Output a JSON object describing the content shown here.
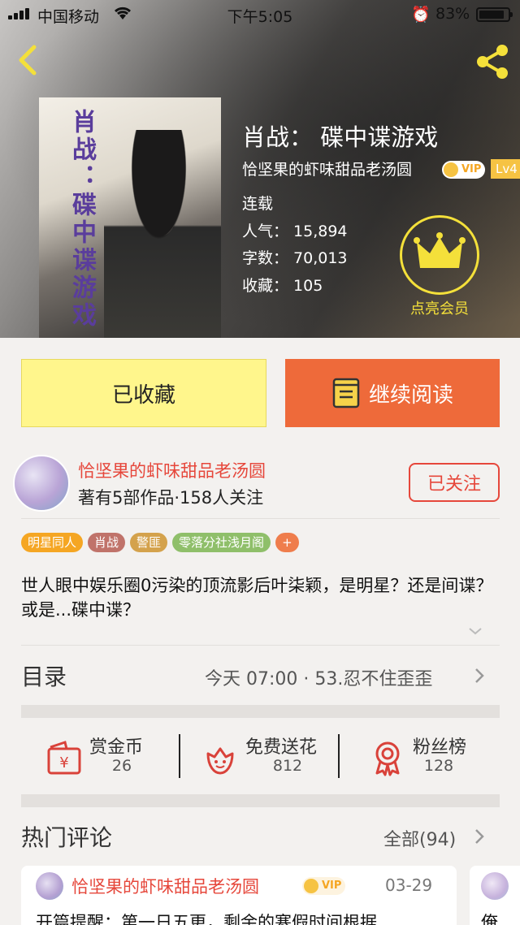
{
  "status": {
    "carrier": "中国移动",
    "time": "下午5:05",
    "battery": "83%"
  },
  "book": {
    "title": "肖战： 碟中谍游戏",
    "cover_text": "肖战：碟中谍游戏",
    "author": "恰坚果的虾味甜品老汤圆",
    "vip": "VIP",
    "level": "Lv4",
    "status": "连载",
    "popularity_label": "人气：",
    "popularity": "15,894",
    "words_label": "字数：",
    "words": "70,013",
    "favorites_label": "收藏：",
    "favorites": "105",
    "member_label": "点亮会员"
  },
  "actions": {
    "collected": "已收藏",
    "continue_read": "继续阅读"
  },
  "author_row": {
    "name": "恰坚果的虾味甜品老汤圆",
    "summary": "著有5部作品·158人关注",
    "follow": "已关注"
  },
  "tags": [
    {
      "label": "明星同人",
      "color": "#f5a623"
    },
    {
      "label": "肖战",
      "color": "#c0736a"
    },
    {
      "label": "警匪",
      "color": "#d4a24c"
    },
    {
      "label": "零落分社浅月阁",
      "color": "#8fbf6a"
    },
    {
      "label": "+",
      "color": "#ef7d4c"
    }
  ],
  "description": "世人眼中娱乐圈0污染的顶流影后叶柒颖，是明星？还是间谍？或是...碟中谍？",
  "toc": {
    "title": "目录",
    "latest": "今天 07:00 · 53.忍不住歪歪"
  },
  "stats": [
    {
      "label": "赏金币",
      "value": "26",
      "icon": "coin-envelope-icon"
    },
    {
      "label": "免费送花",
      "value": "812",
      "icon": "flower-icon"
    },
    {
      "label": "粉丝榜",
      "value": "128",
      "icon": "ribbon-medal-icon"
    }
  ],
  "comments": {
    "title": "热门评论",
    "all": "全部(94)",
    "items": [
      {
        "name": "恰坚果的虾味甜品老汤圆",
        "vip": "VIP",
        "date": "03-29",
        "text": "开篇提醒：第一日五更，剩余的寒假时间根据"
      },
      {
        "text": "俺"
      }
    ]
  },
  "colors": {
    "accent_red": "#e6473b",
    "read_orange": "#ee6a3a",
    "collected_yellow": "#fff68c",
    "member_gold": "#f4e03a"
  }
}
